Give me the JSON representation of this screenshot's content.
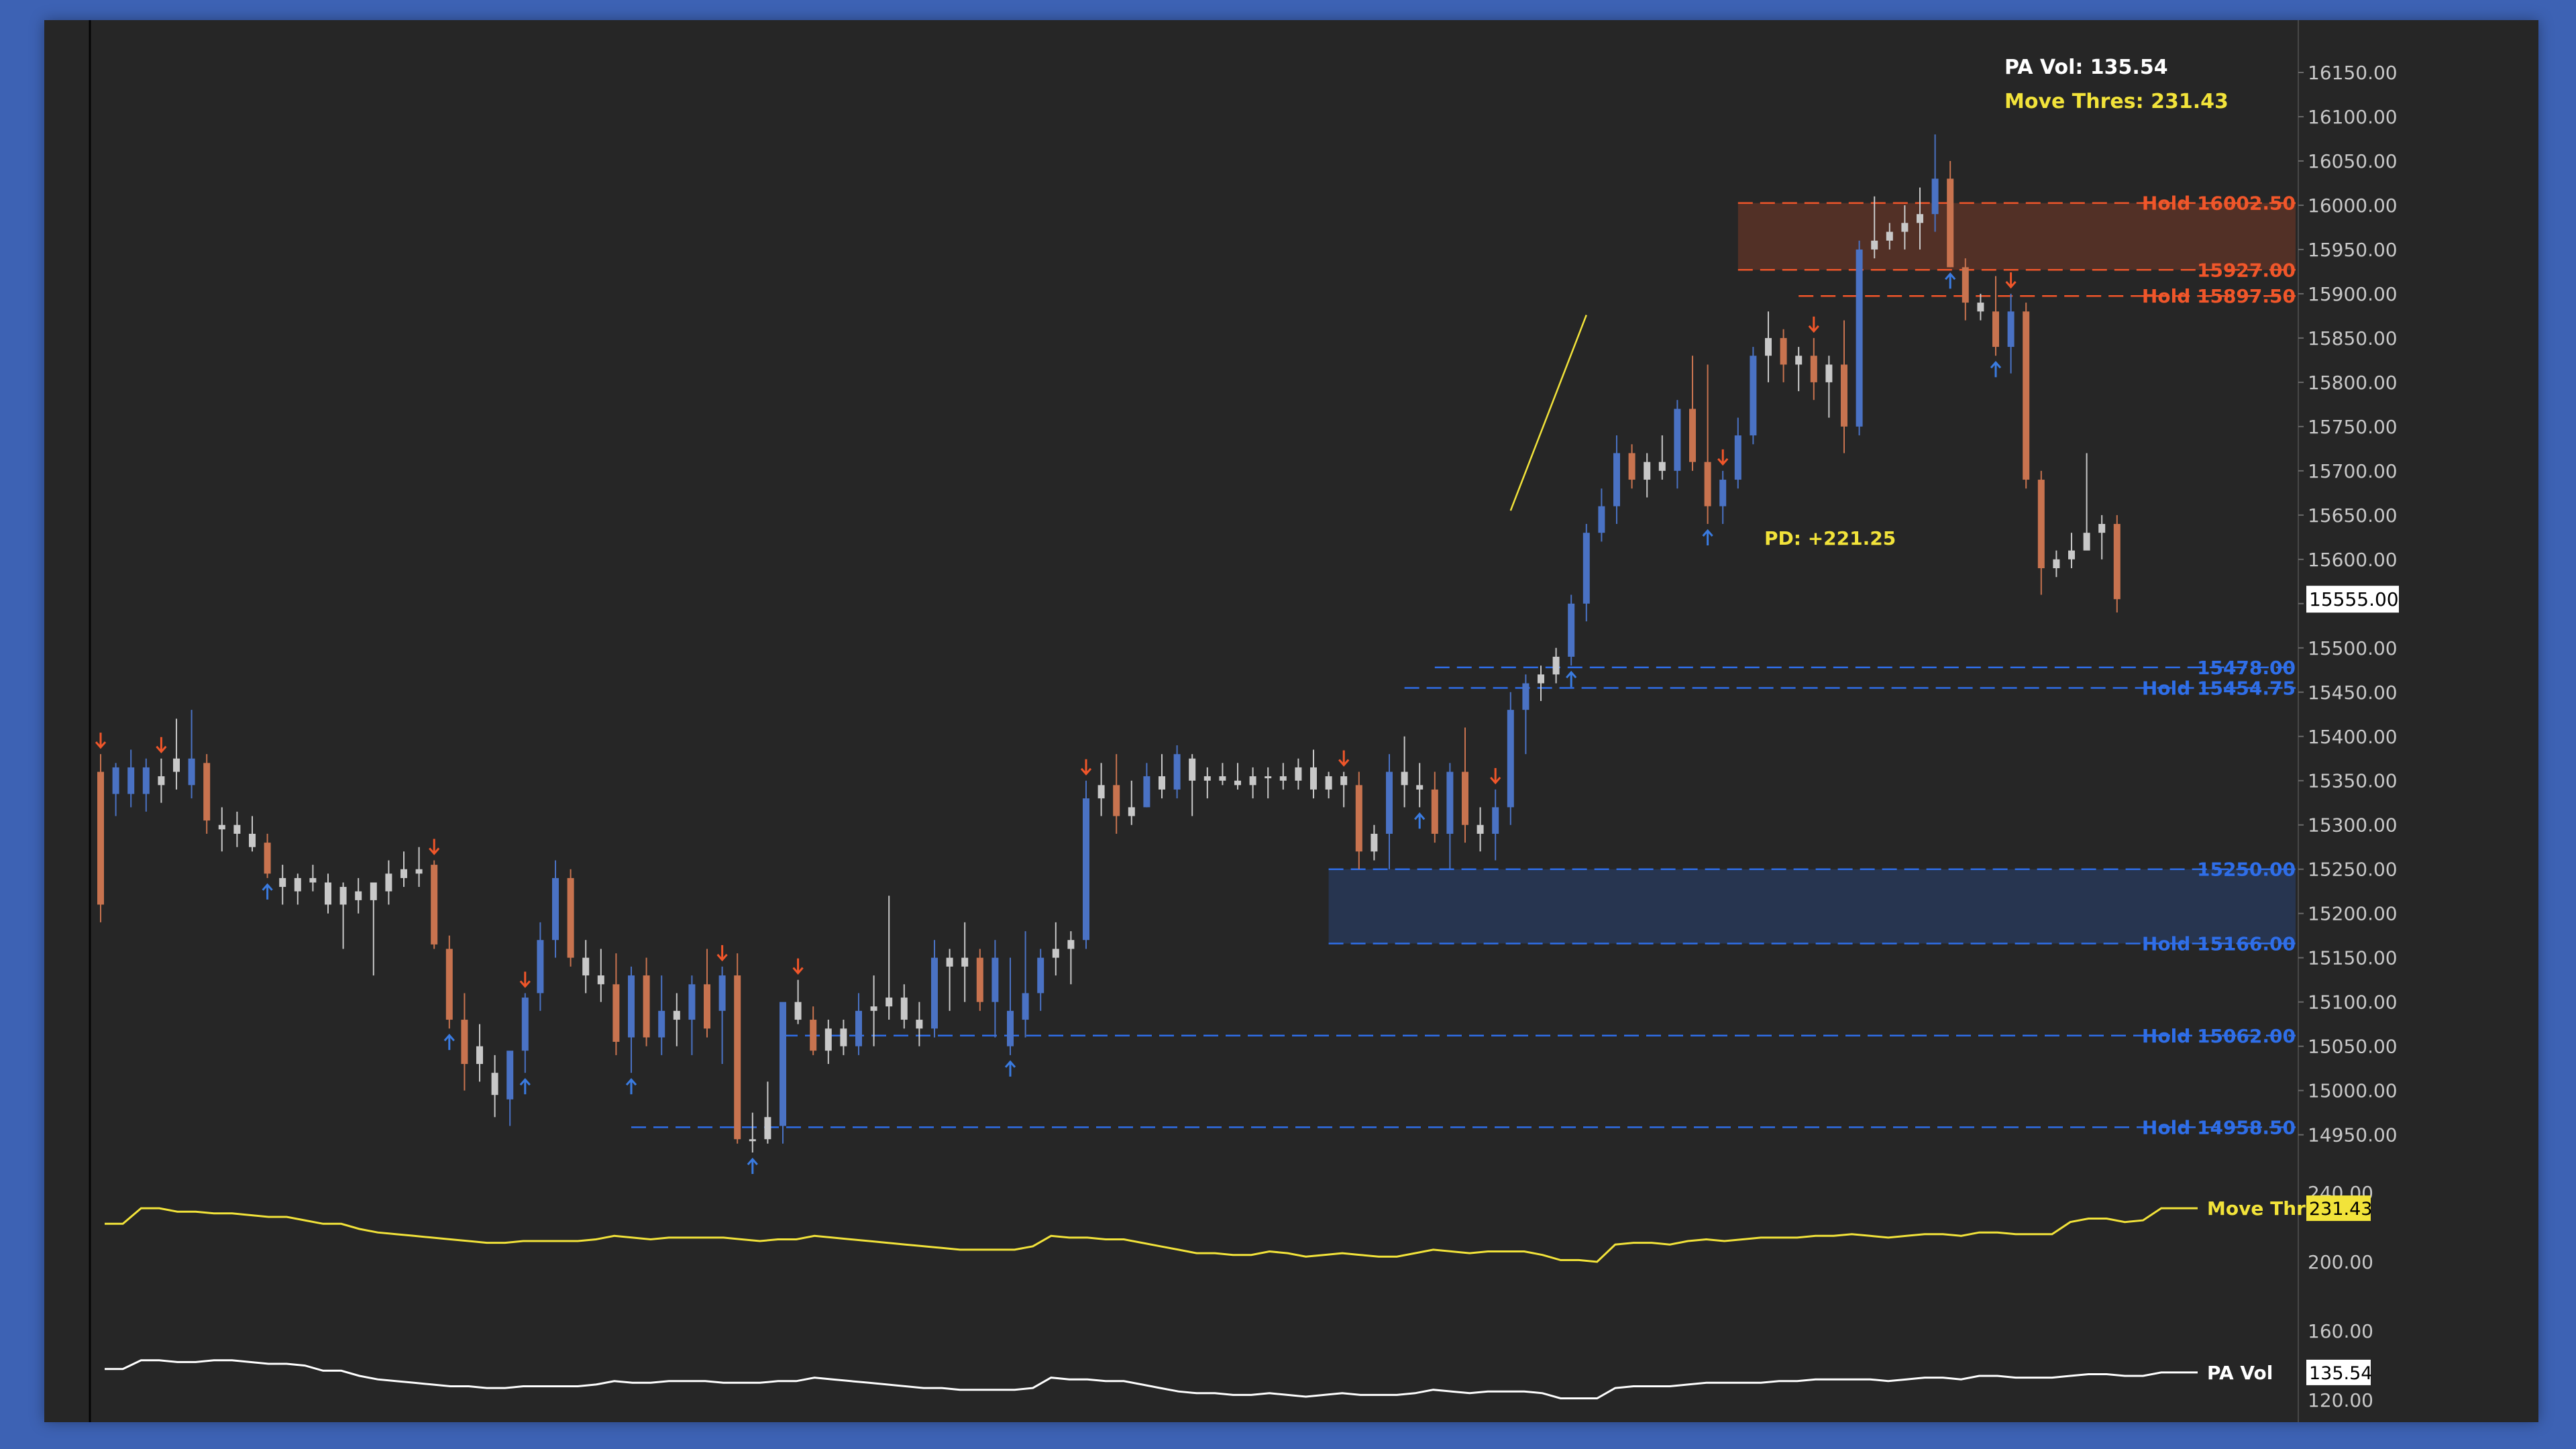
{
  "colors": {
    "background": "#262626",
    "border": "#3d62b4",
    "candle_up": "#4a72c4",
    "candle_down": "#c8734f",
    "candle_neutral": "#c8c8c8",
    "arrow_up": "#3a7be0",
    "arrow_down": "#f0562a",
    "support": "#2f6ee8",
    "resistance": "#f0562a",
    "yellow": "#f2e33a",
    "white": "#ffffff",
    "axis_text": "#c8c8c8"
  },
  "chart_data": {
    "type": "candlestick",
    "price_axis": {
      "ticks": [
        "16150.00",
        "16100.00",
        "16050.00",
        "16000.00",
        "15950.00",
        "15900.00",
        "15850.00",
        "15800.00",
        "15750.00",
        "15700.00",
        "15650.00",
        "15600.00",
        "15550.00",
        "15500.00",
        "15450.00",
        "15400.00",
        "15350.00",
        "15300.00",
        "15250.00",
        "15200.00",
        "15150.00",
        "15100.00",
        "15050.00",
        "15000.00",
        "14950.00"
      ],
      "range": [
        14930,
        16175
      ],
      "current_price": "15555.00"
    },
    "indicator_axis": {
      "ticks": [
        "240.00",
        "200.00",
        "160.00",
        "120.00"
      ],
      "range": [
        115,
        245
      ]
    },
    "header": {
      "pa_vol": "PA Vol: 135.54",
      "move_thres": "Move Thres: 231.43"
    },
    "annotation": "PD: +221.25",
    "levels": [
      {
        "price": 16002.5,
        "label": "Hold  16002.50",
        "kind": "resistance",
        "start": 108
      },
      {
        "price": 15927.0,
        "label": "15927.00",
        "kind": "resistance",
        "start": 108
      },
      {
        "price": 15897.5,
        "label": "Hold  15897.50",
        "kind": "resistance",
        "start": 112
      },
      {
        "price": 15478.0,
        "label": "15478.00",
        "kind": "support",
        "start": 88
      },
      {
        "price": 15454.75,
        "label": "Hold  15454.75",
        "kind": "support",
        "start": 86
      },
      {
        "price": 15250.0,
        "label": "15250.00",
        "kind": "support",
        "start": 81
      },
      {
        "price": 15166.0,
        "label": "Hold  15166.00",
        "kind": "support",
        "start": 81
      },
      {
        "price": 15062.0,
        "label": "Hold  15062.00",
        "kind": "support",
        "start": 45
      },
      {
        "price": 14958.5,
        "label": "Hold  14958.50",
        "kind": "support",
        "start": 35
      }
    ],
    "zones": [
      {
        "top": 16002.5,
        "bottom": 15927.0,
        "kind": "resistance",
        "start": 108
      },
      {
        "top": 15250.0,
        "bottom": 15166.0,
        "kind": "support",
        "start": 81
      }
    ],
    "pd_line": {
      "from_index": 93,
      "from_price": 15655,
      "to_index": 98,
      "to_price": 15876
    },
    "candles": [
      [
        15360,
        15380,
        15190,
        15210
      ],
      [
        15335,
        15370,
        15310,
        15365
      ],
      [
        15335,
        15385,
        15320,
        15365
      ],
      [
        15335,
        15375,
        15315,
        15365
      ],
      [
        15355,
        15375,
        15325,
        15345
      ],
      [
        15360,
        15420,
        15340,
        15375
      ],
      [
        15345,
        15430,
        15330,
        15375
      ],
      [
        15370,
        15380,
        15290,
        15305
      ],
      [
        15300,
        15320,
        15270,
        15295
      ],
      [
        15300,
        15315,
        15275,
        15290
      ],
      [
        15290,
        15310,
        15270,
        15275
      ],
      [
        15280,
        15290,
        15240,
        15245
      ],
      [
        15240,
        15255,
        15210,
        15230
      ],
      [
        15225,
        15245,
        15210,
        15240
      ],
      [
        15240,
        15255,
        15225,
        15235
      ],
      [
        15235,
        15245,
        15200,
        15210
      ],
      [
        15210,
        15235,
        15160,
        15230
      ],
      [
        15225,
        15240,
        15200,
        15215
      ],
      [
        15215,
        15230,
        15130,
        15235
      ],
      [
        15225,
        15260,
        15210,
        15245
      ],
      [
        15240,
        15270,
        15230,
        15250
      ],
      [
        15245,
        15275,
        15230,
        15250
      ],
      [
        15255,
        15260,
        15160,
        15165
      ],
      [
        15160,
        15175,
        15070,
        15080
      ],
      [
        15080,
        15110,
        15000,
        15030
      ],
      [
        15030,
        15075,
        15010,
        15050
      ],
      [
        15020,
        15040,
        14970,
        14995
      ],
      [
        14990,
        15040,
        14960,
        15045
      ],
      [
        15045,
        15110,
        15020,
        15105
      ],
      [
        15110,
        15190,
        15090,
        15170
      ],
      [
        15170,
        15260,
        15150,
        15240
      ],
      [
        15240,
        15250,
        15140,
        15150
      ],
      [
        15150,
        15170,
        15110,
        15130
      ],
      [
        15130,
        15160,
        15100,
        15120
      ],
      [
        15120,
        15155,
        15040,
        15055
      ],
      [
        15060,
        15140,
        15020,
        15130
      ],
      [
        15130,
        15150,
        15050,
        15060
      ],
      [
        15060,
        15130,
        15040,
        15090
      ],
      [
        15090,
        15110,
        15050,
        15080
      ],
      [
        15080,
        15130,
        15040,
        15120
      ],
      [
        15120,
        15160,
        15060,
        15070
      ],
      [
        15090,
        15140,
        15030,
        15130
      ],
      [
        15130,
        15155,
        14940,
        14945
      ],
      [
        14945,
        14975,
        14930,
        14945
      ],
      [
        14945,
        15010,
        14940,
        14970
      ],
      [
        14960,
        15080,
        14940,
        15100
      ],
      [
        15100,
        15125,
        15075,
        15080
      ],
      [
        15080,
        15095,
        15040,
        15045
      ],
      [
        15045,
        15080,
        15030,
        15070
      ],
      [
        15070,
        15080,
        15040,
        15050
      ],
      [
        15050,
        15110,
        15040,
        15090
      ],
      [
        15090,
        15130,
        15050,
        15095
      ],
      [
        15095,
        15220,
        15080,
        15105
      ],
      [
        15105,
        15120,
        15070,
        15080
      ],
      [
        15080,
        15100,
        15050,
        15070
      ],
      [
        15070,
        15170,
        15060,
        15150
      ],
      [
        15150,
        15160,
        15090,
        15140
      ],
      [
        15140,
        15190,
        15100,
        15150
      ],
      [
        15150,
        15160,
        15090,
        15100
      ],
      [
        15100,
        15170,
        15060,
        15150
      ],
      [
        15050,
        15150,
        15040,
        15090
      ],
      [
        15080,
        15180,
        15060,
        15110
      ],
      [
        15110,
        15160,
        15090,
        15150
      ],
      [
        15150,
        15190,
        15130,
        15160
      ],
      [
        15160,
        15180,
        15120,
        15170
      ],
      [
        15170,
        15350,
        15160,
        15330
      ],
      [
        15330,
        15370,
        15310,
        15345
      ],
      [
        15345,
        15380,
        15290,
        15310
      ],
      [
        15310,
        15350,
        15300,
        15320
      ],
      [
        15320,
        15370,
        15320,
        15355
      ],
      [
        15355,
        15380,
        15330,
        15340
      ],
      [
        15340,
        15390,
        15330,
        15380
      ],
      [
        15375,
        15380,
        15310,
        15350
      ],
      [
        15350,
        15365,
        15330,
        15355
      ],
      [
        15355,
        15370,
        15345,
        15350
      ],
      [
        15350,
        15370,
        15340,
        15345
      ],
      [
        15345,
        15365,
        15330,
        15355
      ],
      [
        15355,
        15365,
        15330,
        15355
      ],
      [
        15355,
        15370,
        15340,
        15350
      ],
      [
        15350,
        15375,
        15340,
        15365
      ],
      [
        15365,
        15385,
        15330,
        15340
      ],
      [
        15340,
        15360,
        15330,
        15355
      ],
      [
        15355,
        15360,
        15320,
        15345
      ],
      [
        15345,
        15360,
        15250,
        15270
      ],
      [
        15270,
        15300,
        15260,
        15290
      ],
      [
        15290,
        15380,
        15250,
        15360
      ],
      [
        15360,
        15400,
        15320,
        15345
      ],
      [
        15345,
        15370,
        15320,
        15340
      ],
      [
        15340,
        15360,
        15280,
        15290
      ]
    ],
    "move_thres_series": [
      222,
      222,
      231,
      231,
      229,
      229,
      228,
      228,
      227,
      226,
      226,
      224,
      222,
      222,
      219,
      217,
      216,
      215,
      214,
      213,
      212,
      211,
      211,
      212,
      212,
      212,
      212,
      213,
      215,
      214,
      213,
      214,
      214,
      214,
      214,
      213,
      212,
      213,
      213,
      215,
      214,
      213,
      212,
      211,
      210,
      209,
      208,
      207,
      207,
      207,
      207,
      209,
      215,
      214,
      214,
      213,
      213,
      211,
      209,
      207,
      205,
      205,
      204,
      204,
      206,
      205,
      203,
      204,
      205,
      204,
      203,
      203,
      205,
      207,
      206,
      205,
      206,
      206,
      206,
      204,
      201,
      201,
      200,
      210,
      211,
      211,
      210,
      212,
      213,
      212,
      213,
      214,
      214,
      214,
      215,
      215,
      216,
      215,
      214,
      215,
      216,
      216,
      215,
      217,
      217,
      216,
      216,
      216,
      223,
      225,
      225,
      223,
      224,
      231,
      231,
      231
    ],
    "pa_vol_series": [
      138,
      138,
      143,
      143,
      142,
      142,
      143,
      143,
      142,
      141,
      141,
      140,
      137,
      137,
      134,
      132,
      131,
      130,
      129,
      128,
      128,
      127,
      127,
      128,
      128,
      128,
      128,
      129,
      131,
      130,
      130,
      131,
      131,
      131,
      130,
      130,
      130,
      131,
      131,
      133,
      132,
      131,
      130,
      129,
      128,
      127,
      127,
      126,
      126,
      126,
      126,
      127,
      133,
      132,
      132,
      131,
      131,
      129,
      127,
      125,
      124,
      124,
      123,
      123,
      124,
      123,
      122,
      123,
      124,
      123,
      123,
      123,
      124,
      126,
      125,
      124,
      125,
      125,
      125,
      124,
      121,
      121,
      121,
      127,
      128,
      128,
      128,
      129,
      130,
      130,
      130,
      130,
      131,
      131,
      132,
      132,
      132,
      132,
      131,
      132,
      133,
      133,
      132,
      134,
      134,
      133,
      133,
      133,
      134,
      135,
      135,
      134,
      134,
      136,
      136,
      136
    ],
    "legend": {
      "move_thres": "Move Thres",
      "move_thres_value": "231.43",
      "pa_vol": "PA Vol",
      "pa_vol_value": "135.54"
    }
  }
}
